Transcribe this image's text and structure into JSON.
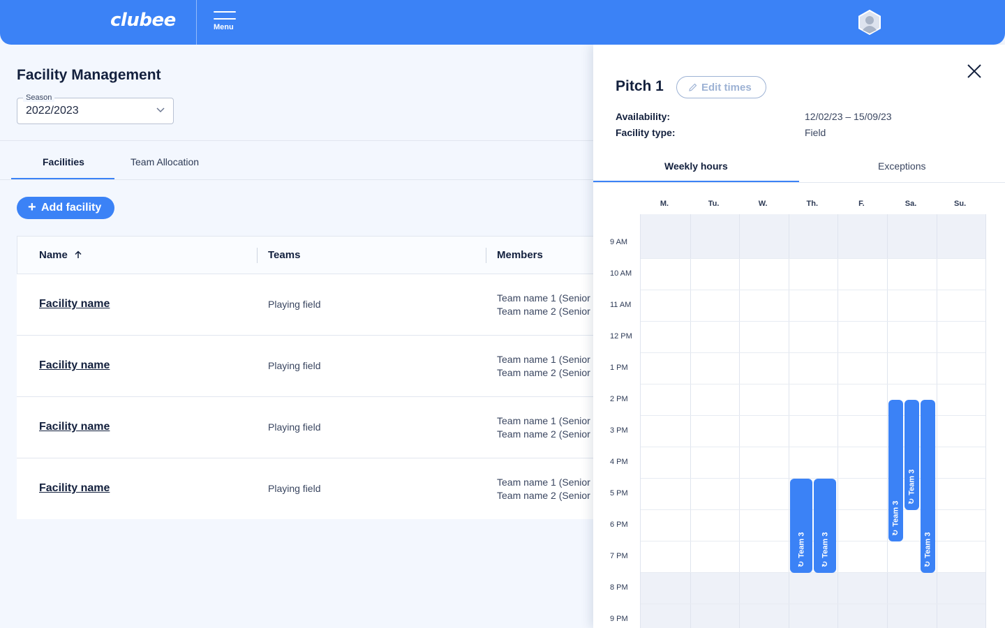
{
  "header": {
    "logo_text": "clubee",
    "menu_label": "Menu"
  },
  "page": {
    "title": "Facility Management",
    "season_label": "Season",
    "season_value": "2022/2023"
  },
  "tabs": [
    {
      "label": "Facilities",
      "active": true
    },
    {
      "label": "Team Allocation",
      "active": false
    }
  ],
  "add_button_label": "Add facility",
  "table": {
    "columns": [
      "Name",
      "Teams",
      "Members"
    ],
    "sort_column": "Name",
    "rows": [
      {
        "name": "Facility name",
        "teams": "Playing field",
        "members": [
          "Team name 1 (Senior",
          "Team name 2 (Senior"
        ]
      },
      {
        "name": "Facility name",
        "teams": "Playing field",
        "members": [
          "Team name 1 (Senior",
          "Team name 2 (Senior"
        ]
      },
      {
        "name": "Facility name",
        "teams": "Playing field",
        "members": [
          "Team name 1 (Senior",
          "Team name 2 (Senior"
        ]
      },
      {
        "name": "Facility name",
        "teams": "Playing field",
        "members": [
          "Team name 1 (Senior",
          "Team name 2 (Senior"
        ]
      }
    ]
  },
  "panel": {
    "title": "Pitch 1",
    "edit_label": "Edit times",
    "availability_label": "Availability:",
    "availability_value": "12/02/23 – 15/09/23",
    "facility_type_label": "Facility type:",
    "facility_type_value": "Field",
    "tabs": [
      {
        "label": "Weekly hours",
        "active": true
      },
      {
        "label": "Exceptions",
        "active": false
      }
    ],
    "days": [
      "M.",
      "Tu.",
      "W.",
      "Th.",
      "F.",
      "Sa.",
      "Su."
    ],
    "hours": [
      "9 AM",
      "10 AM",
      "11 AM",
      "12 PM",
      "1 PM",
      "2 PM",
      "3 PM",
      "4 PM",
      "5 PM",
      "6 PM",
      "7 PM",
      "8 PM",
      "9 PM"
    ],
    "events": [
      {
        "label": "Team 3",
        "day": 3,
        "sub": 0,
        "subs": 2,
        "start": 16.5,
        "end": 19.5
      },
      {
        "label": "Team 3",
        "day": 3,
        "sub": 1,
        "subs": 2,
        "start": 16.5,
        "end": 19.5
      },
      {
        "label": "Team 3",
        "day": 5,
        "sub": 0,
        "subs": 3,
        "start": 14,
        "end": 18.5
      },
      {
        "label": "Team 3",
        "day": 5,
        "sub": 1,
        "subs": 3,
        "start": 14,
        "end": 17.5
      },
      {
        "label": "Team 3",
        "day": 5,
        "sub": 2,
        "subs": 3,
        "start": 14,
        "end": 19.5
      }
    ]
  },
  "colors": {
    "accent": "#3b82f6",
    "background": "#f3f7fe",
    "text": "#13203d"
  }
}
